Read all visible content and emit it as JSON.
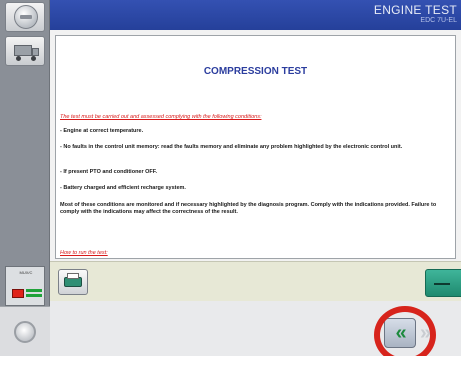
{
  "header": {
    "title": "ENGINE TEST",
    "subtitle": "EDC 7U-EL"
  },
  "sidebar": {
    "status_label": "MUX/C"
  },
  "document": {
    "title": "COMPRESSION TEST",
    "warning": "The test must be carried out and assessed complying with the following conditions:",
    "conditions": [
      "- Engine at correct temperature.",
      "- No faults in the control unit memory: read the faults memory and eliminate any problem highlighted by the electronic control unit.",
      "- If present PTO and conditioner OFF.",
      "- Battery charged and efficient recharge system."
    ],
    "note": "Most of these conditions are monitored and if necessary highlighted by the diagnosis program. Comply with the indications provided. Failure to comply with the indications may affect the correctness of the result.",
    "how_to": "How to run the test:"
  },
  "nav": {
    "back_glyph": "«",
    "forward_glyph": "»"
  },
  "colors": {
    "header": "#2b47a6",
    "title_blue": "#2b3d9e",
    "warning_red": "#d81a1a",
    "highlight_circle": "#d7241c",
    "back_arrow_green": "#1c8a3d"
  }
}
